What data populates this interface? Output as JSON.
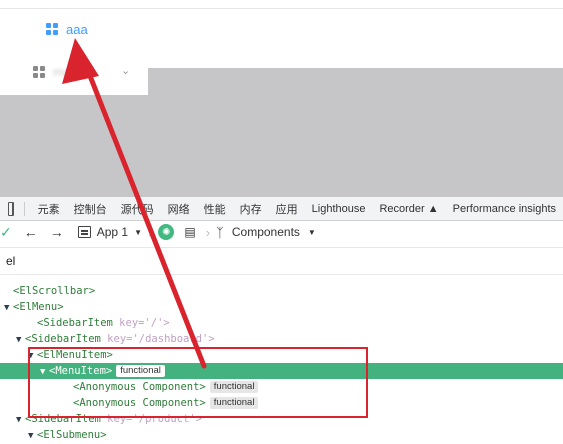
{
  "app": {
    "menu_active_label": "aaa",
    "menu_blur_label": "mani"
  },
  "devtools_tabs": [
    "元素",
    "控制台",
    "源代码",
    "网络",
    "性能",
    "内存",
    "应用",
    "Lighthouse",
    "Recorder",
    "Performance insights"
  ],
  "vue_toolbar": {
    "app_label": "App 1",
    "components_label": "Components"
  },
  "search": {
    "value": "el"
  },
  "tree": [
    {
      "indent": 0,
      "toggle": "",
      "tag": "<ElScrollbar>",
      "attrs": "",
      "badge": ""
    },
    {
      "indent": 0,
      "toggle": "▼",
      "tag": "<ElMenu>",
      "attrs": "",
      "badge": ""
    },
    {
      "indent": 2,
      "toggle": "",
      "tag": "<SidebarItem",
      "attrs": " key='/'>",
      "badge": ""
    },
    {
      "indent": 1,
      "toggle": "▼",
      "tag": "<SidebarItem",
      "attrs": " key='/dashboard'>",
      "badge": ""
    },
    {
      "indent": 2,
      "toggle": "▼",
      "tag": "<ElMenuItem>",
      "attrs": "",
      "badge": ""
    },
    {
      "indent": 3,
      "toggle": "▼",
      "tag": "<MenuItem>",
      "attrs": "",
      "badge": "functional",
      "selected": true
    },
    {
      "indent": 5,
      "toggle": "",
      "tag": "<Anonymous Component>",
      "attrs": "",
      "badge": "functional"
    },
    {
      "indent": 5,
      "toggle": "",
      "tag": "<Anonymous Component>",
      "attrs": "",
      "badge": "functional"
    },
    {
      "indent": 1,
      "toggle": "▼",
      "tag": "<SidebarItem",
      "attrs": " key='/product'>",
      "badge": ""
    },
    {
      "indent": 2,
      "toggle": "▼",
      "tag": "<ElSubmenu>",
      "attrs": "",
      "badge": ""
    }
  ],
  "colors": {
    "accent_blue": "#409eff",
    "vue_green": "#42b883",
    "selected_row": "#44b27e",
    "annotation_red": "#d9232d"
  }
}
